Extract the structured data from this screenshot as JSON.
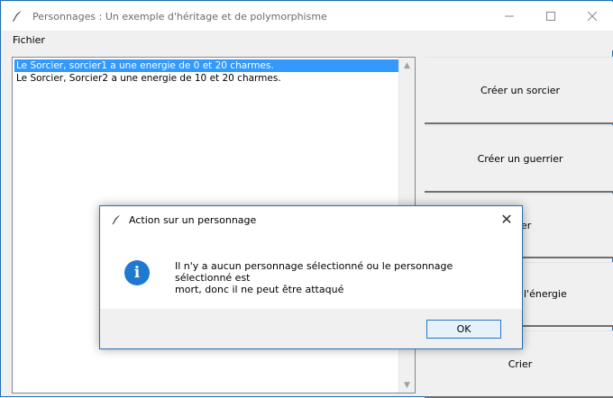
{
  "window": {
    "title": "Personnages : Un exemple d'héritage et de polymorphisme",
    "icon": "feather-icon",
    "controls": [
      "minimize",
      "maximize",
      "close"
    ]
  },
  "menu": {
    "items": [
      "Fichier"
    ]
  },
  "list": {
    "rows": [
      {
        "text": "Le Sorcier, sorcier1 a une energie de 0 et 20 charmes.",
        "selected": true
      },
      {
        "text": "Le Sorcier, Sorcier2 a une energie de 10 et 20 charmes.",
        "selected": false
      }
    ]
  },
  "buttons": {
    "create_sorcier": "Créer un sorcier",
    "create_guerrier": "Créer un guerrier",
    "attack_partial": "uer",
    "energy_partial": "l'énergie",
    "shout": "Crier"
  },
  "dialog": {
    "title": "Action sur un personnage",
    "icon": "info-icon",
    "message": "Il n'y a aucun personnage sélectionné ou le personnage sélectionné est\nmort, donc il ne peut être attaqué",
    "ok_label": "OK",
    "close_symbol": "✕"
  },
  "colors": {
    "selection": "#3399ff",
    "accent": "#1f79d0"
  }
}
